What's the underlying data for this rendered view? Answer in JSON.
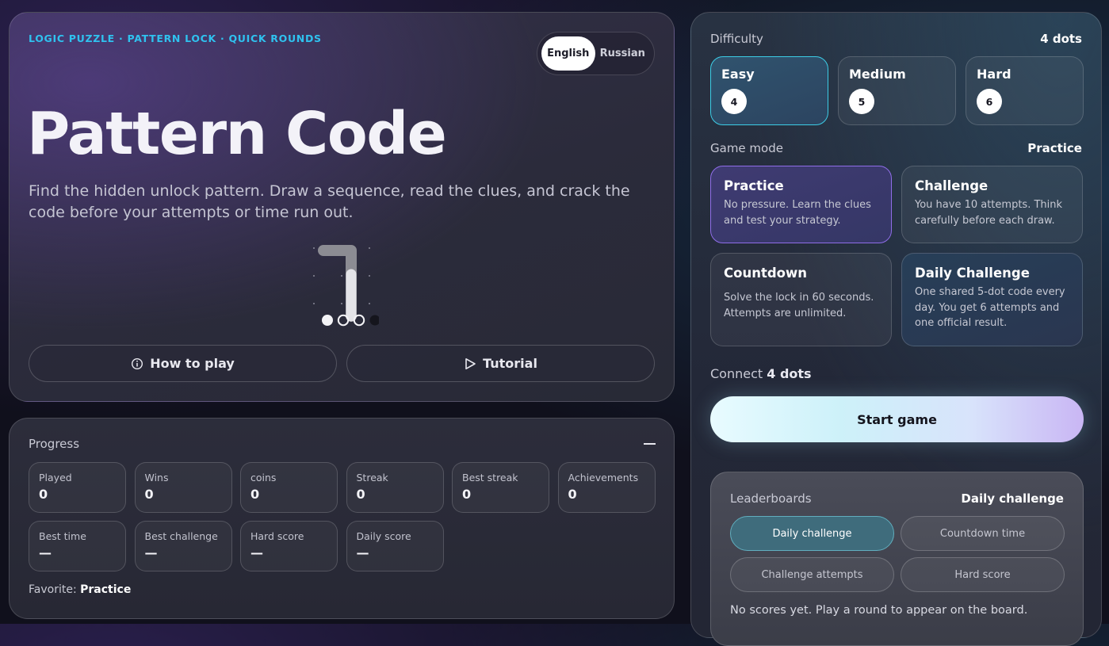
{
  "hero": {
    "tagline": "LOGIC PUZZLE · PATTERN LOCK · QUICK ROUNDS",
    "languages": [
      "English",
      "Russian"
    ],
    "selected_language": "English",
    "title": "Pattern Code",
    "description": "Find the hidden unlock pattern. Draw a sequence, read the clues, and crack the code before your attempts or time run out.",
    "preview_progress": {
      "filled": 1,
      "hollow": 2,
      "empty": 1
    },
    "how_to_play_label": "How to play",
    "tutorial_label": "Tutorial"
  },
  "progress": {
    "title": "Progress",
    "stats": [
      {
        "label": "Played",
        "value": "0"
      },
      {
        "label": "Wins",
        "value": "0"
      },
      {
        "label": "coins",
        "value": "0"
      },
      {
        "label": "Streak",
        "value": "0"
      },
      {
        "label": "Best streak",
        "value": "0"
      },
      {
        "label": "Achievements",
        "value": "0"
      },
      {
        "label": "Best time",
        "value": "—"
      },
      {
        "label": "Best challenge",
        "value": "—"
      },
      {
        "label": "Hard score",
        "value": "—"
      },
      {
        "label": "Daily score",
        "value": "—"
      }
    ],
    "favorite_label": "Favorite:",
    "favorite_value": "Practice"
  },
  "config": {
    "difficulty_label": "Difficulty",
    "difficulty_value": "4 dots",
    "difficulties": [
      {
        "name": "Easy",
        "dots": "4"
      },
      {
        "name": "Medium",
        "dots": "5"
      },
      {
        "name": "Hard",
        "dots": "6"
      }
    ],
    "mode_label": "Game mode",
    "mode_value": "Practice",
    "modes": [
      {
        "name": "Practice",
        "desc": "No pressure. Learn the clues and test your strategy."
      },
      {
        "name": "Challenge",
        "desc": "You have 10 attempts. Think carefully before each draw."
      },
      {
        "name": "Countdown",
        "desc": "Solve the lock in 60 seconds. Attempts are unlimited."
      },
      {
        "name": "Daily Challenge",
        "desc": "One shared 5-dot code every day. You get 6 attempts and one official result."
      }
    ],
    "connect_prefix": "Connect",
    "connect_value": "4 dots",
    "start_label": "Start game"
  },
  "leaderboards": {
    "title": "Leaderboards",
    "selected": "Daily challenge",
    "tabs": [
      "Daily challenge",
      "Countdown time",
      "Challenge attempts",
      "Hard score"
    ],
    "empty_text": "No scores yet. Play a round to appear on the board."
  },
  "colors": {
    "accent_cyan": "#2fc2ef",
    "selected_purple": "#8f6de8",
    "selected_cyan": "#3ccde6"
  }
}
